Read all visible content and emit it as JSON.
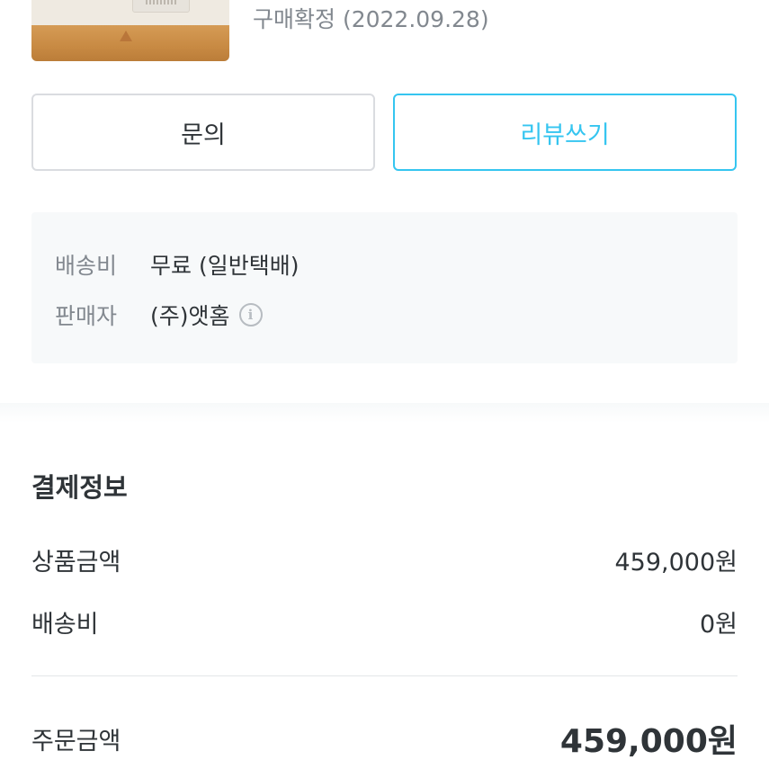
{
  "order": {
    "status": "구매확정 (2022.09.28)"
  },
  "actions": {
    "inquiry_label": "문의",
    "review_label": "리뷰쓰기"
  },
  "shipping_info": {
    "fee_label": "배송비",
    "fee_value": "무료 (일반택배)",
    "seller_label": "판매자",
    "seller_value": "(주)앳홈",
    "seller_info_icon": "info-circle-icon"
  },
  "payment": {
    "title": "결제정보",
    "product_amount_label": "상품금액",
    "product_amount_value": "459,000원",
    "shipping_fee_label": "배송비",
    "shipping_fee_value": "0원",
    "total_label": "주문금액",
    "total_value": "459,000원"
  },
  "colors": {
    "accent": "#35c5f0",
    "text_primary": "#2f3438",
    "text_secondary": "#82888f",
    "info_bg": "#f7f9fa"
  }
}
